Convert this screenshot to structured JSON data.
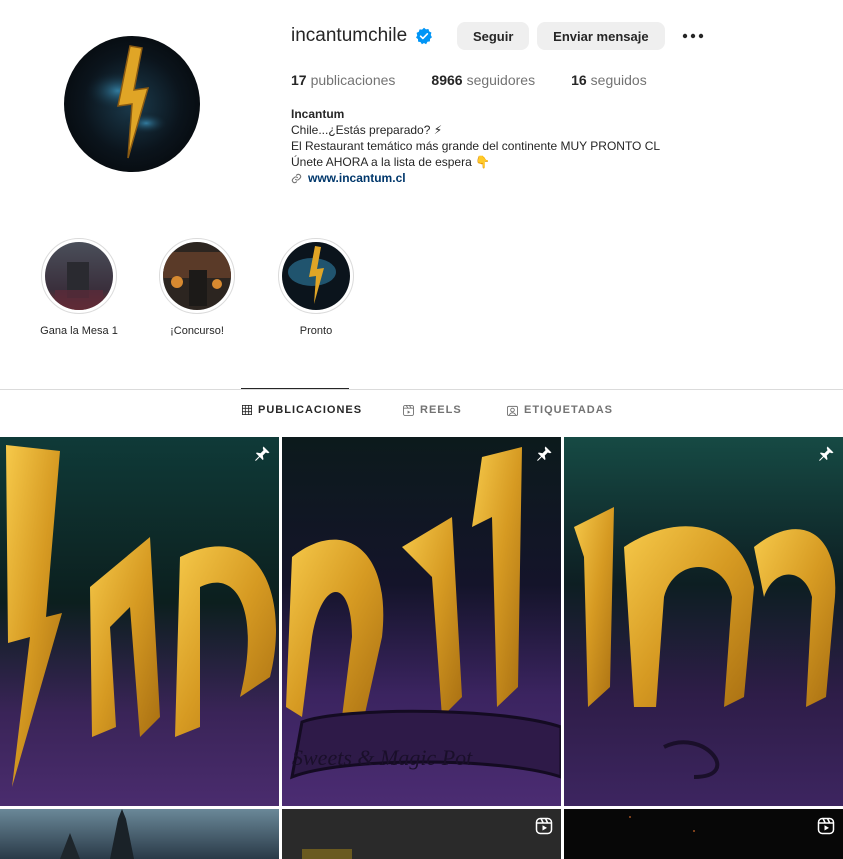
{
  "profile": {
    "username": "incantumchile",
    "follow_label": "Seguir",
    "message_label": "Enviar mensaje",
    "stats": {
      "posts_count": "17",
      "posts_label": "publicaciones",
      "followers_count": "8966",
      "followers_label": "seguidores",
      "following_count": "16",
      "following_label": "seguidos"
    },
    "bio": {
      "name": "Incantum",
      "line1": "Chile...¿Estás preparado? ⚡",
      "line2": "El Restaurant temático más grande del continente MUY PRONTO CL",
      "line3": "Únete AHORA a la lista de espera 👇",
      "link": "www.incantum.cl"
    }
  },
  "highlights": [
    {
      "label": "Gana la Mesa 1"
    },
    {
      "label": "¡Concurso!"
    },
    {
      "label": "Pronto"
    }
  ],
  "tabs": [
    {
      "label": "PUBLICACIONES",
      "active": true
    },
    {
      "label": "REELS",
      "active": false
    },
    {
      "label": "ETIQUETADAS",
      "active": false
    }
  ],
  "posts": [
    {
      "badge": "pin-icon"
    },
    {
      "badge": "pin-icon",
      "caption": "Sweets & Magic Pot"
    },
    {
      "badge": "pin-icon"
    },
    {
      "badge": ""
    },
    {
      "badge": "reel-icon"
    },
    {
      "badge": "reel-icon"
    }
  ],
  "colors": {
    "verified": "#0095f6",
    "link": "#00376b",
    "gold": "#e0a526"
  }
}
